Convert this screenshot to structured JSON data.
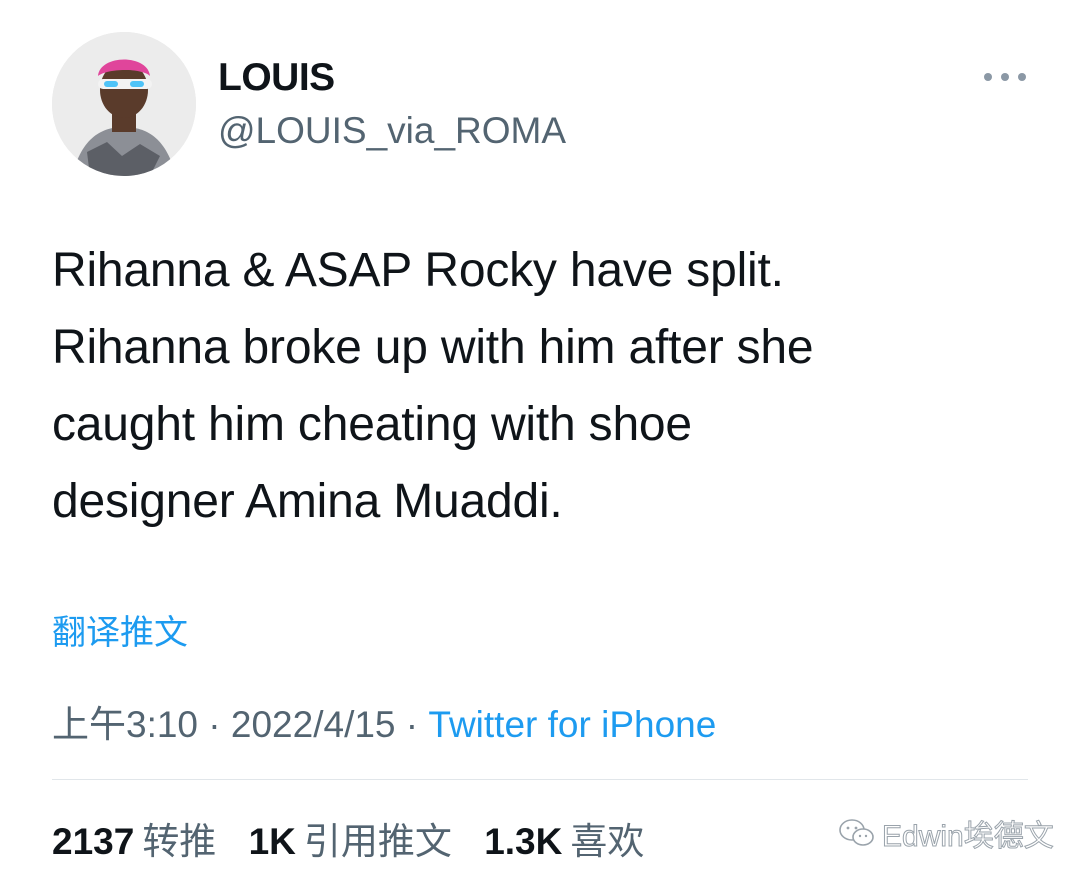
{
  "author": {
    "display_name": "LOUIS",
    "handle": "@LOUIS_via_ROMA"
  },
  "tweet": {
    "lines": [
      "Rihanna & ASAP Rocky have split.",
      "Rihanna broke up with him after she",
      "caught him cheating with shoe",
      "designer Amina Muaddi."
    ],
    "translate_label": "翻译推文",
    "time": "上午3:10",
    "separator": "·",
    "date": "2022/4/15",
    "source": "Twitter for iPhone"
  },
  "stats": {
    "retweets_count": "2137",
    "retweets_label": "转推",
    "quotes_count": "1K",
    "quotes_label": "引用推文",
    "likes_count": "1.3K",
    "likes_label": "喜欢"
  },
  "watermark": {
    "text": "Edwin埃德文",
    "icon": "wechat-icon"
  },
  "colors": {
    "link": "#1d9bf0",
    "secondary_text": "#536471",
    "primary_text": "#0f1419"
  }
}
